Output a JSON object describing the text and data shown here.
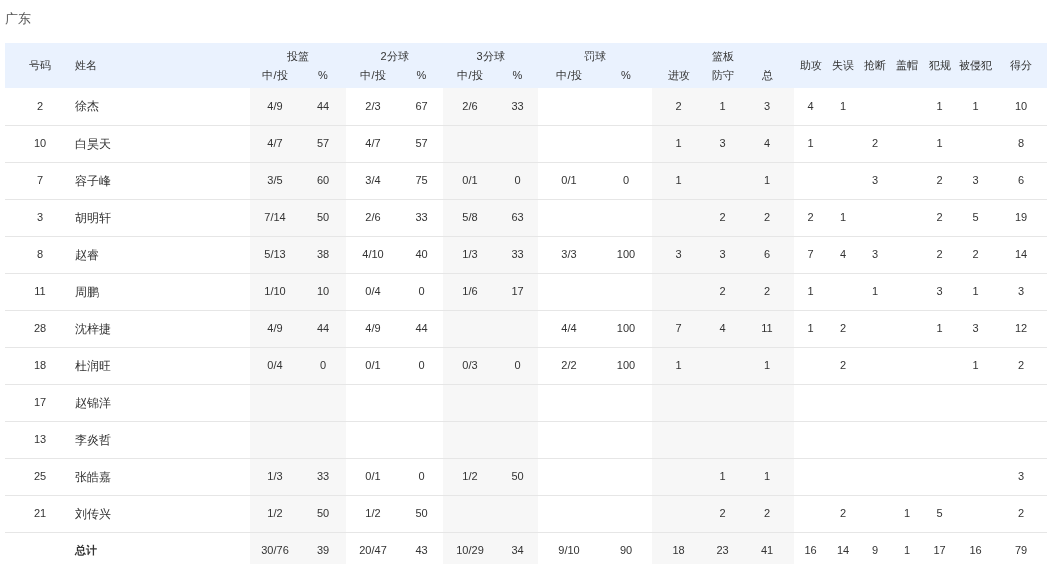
{
  "title": "广东",
  "table": {
    "header": {
      "number": "号码",
      "name": "姓名",
      "groups": [
        {
          "label": "投篮",
          "sub": [
            "中/投",
            "%"
          ]
        },
        {
          "label": "2分球",
          "sub": [
            "中/投",
            "%"
          ]
        },
        {
          "label": "3分球",
          "sub": [
            "中/投",
            "%"
          ]
        },
        {
          "label": "罚球",
          "sub": [
            "中/投",
            "%"
          ]
        },
        {
          "label": "篮板",
          "sub": [
            "进攻",
            "防守",
            "总"
          ]
        }
      ],
      "singles": [
        "助攻",
        "失误",
        "抢断",
        "盖帽",
        "犯规",
        "被侵犯",
        "得分"
      ]
    },
    "rows": [
      {
        "kind": "player",
        "number": "2",
        "name": "徐杰",
        "stats": {
          "fg": "4/9",
          "fg_pct": "44",
          "p2": "2/3",
          "p2_pct": "67",
          "p3": "2/6",
          "p3_pct": "33",
          "oreb": "2",
          "dreb": "1",
          "reb": "3",
          "ast": "4",
          "to": "1",
          "pf": "1",
          "fd": "1",
          "pts": "10"
        }
      },
      {
        "kind": "player",
        "number": "10",
        "name": "白昊天",
        "stats": {
          "fg": "4/7",
          "fg_pct": "57",
          "p2": "4/7",
          "p2_pct": "57",
          "oreb": "1",
          "dreb": "3",
          "reb": "4",
          "ast": "1",
          "stl": "2",
          "pf": "1",
          "pts": "8"
        }
      },
      {
        "kind": "player",
        "number": "7",
        "name": "容子峰",
        "stats": {
          "fg": "3/5",
          "fg_pct": "60",
          "p2": "3/4",
          "p2_pct": "75",
          "p3": "0/1",
          "p3_pct": "0",
          "ft": "0/1",
          "ft_pct": "0",
          "oreb": "1",
          "reb": "1",
          "stl": "3",
          "pf": "2",
          "fd": "3",
          "pts": "6"
        }
      },
      {
        "kind": "player",
        "number": "3",
        "name": "胡明轩",
        "stats": {
          "fg": "7/14",
          "fg_pct": "50",
          "p2": "2/6",
          "p2_pct": "33",
          "p3": "5/8",
          "p3_pct": "63",
          "dreb": "2",
          "reb": "2",
          "ast": "2",
          "to": "1",
          "pf": "2",
          "fd": "5",
          "pts": "19"
        }
      },
      {
        "kind": "player",
        "number": "8",
        "name": "赵睿",
        "stats": {
          "fg": "5/13",
          "fg_pct": "38",
          "p2": "4/10",
          "p2_pct": "40",
          "p3": "1/3",
          "p3_pct": "33",
          "ft": "3/3",
          "ft_pct": "100",
          "oreb": "3",
          "dreb": "3",
          "reb": "6",
          "ast": "7",
          "to": "4",
          "stl": "3",
          "pf": "2",
          "fd": "2",
          "pts": "14"
        }
      },
      {
        "kind": "player",
        "number": "11",
        "name": "周鹏",
        "stats": {
          "fg": "1/10",
          "fg_pct": "10",
          "p2": "0/4",
          "p2_pct": "0",
          "p3": "1/6",
          "p3_pct": "17",
          "dreb": "2",
          "reb": "2",
          "ast": "1",
          "stl": "1",
          "pf": "3",
          "fd": "1",
          "pts": "3"
        }
      },
      {
        "kind": "player",
        "number": "28",
        "name": "沈梓捷",
        "stats": {
          "fg": "4/9",
          "fg_pct": "44",
          "p2": "4/9",
          "p2_pct": "44",
          "ft": "4/4",
          "ft_pct": "100",
          "oreb": "7",
          "dreb": "4",
          "reb": "11",
          "ast": "1",
          "to": "2",
          "pf": "1",
          "fd": "3",
          "pts": "12"
        }
      },
      {
        "kind": "player",
        "number": "18",
        "name": "杜润旺",
        "stats": {
          "fg": "0/4",
          "fg_pct": "0",
          "p2": "0/1",
          "p2_pct": "0",
          "p3": "0/3",
          "p3_pct": "0",
          "ft": "2/2",
          "ft_pct": "100",
          "oreb": "1",
          "reb": "1",
          "to": "2",
          "fd": "1",
          "pts": "2"
        }
      },
      {
        "kind": "player",
        "number": "17",
        "name": "赵锦洋",
        "stats": {}
      },
      {
        "kind": "player",
        "number": "13",
        "name": "李炎哲",
        "stats": {}
      },
      {
        "kind": "player",
        "number": "25",
        "name": "张皓嘉",
        "stats": {
          "fg": "1/3",
          "fg_pct": "33",
          "p2": "0/1",
          "p2_pct": "0",
          "p3": "1/2",
          "p3_pct": "50",
          "dreb": "1",
          "reb": "1",
          "pts": "3"
        }
      },
      {
        "kind": "player",
        "number": "21",
        "name": "刘传兴",
        "stats": {
          "fg": "1/2",
          "fg_pct": "50",
          "p2": "1/2",
          "p2_pct": "50",
          "dreb": "2",
          "reb": "2",
          "to": "2",
          "blk": "1",
          "pf": "5",
          "pts": "2"
        }
      },
      {
        "kind": "total",
        "name": "总计",
        "stats": {
          "fg": "30/76",
          "fg_pct": "39",
          "p2": "20/47",
          "p2_pct": "43",
          "p3": "10/29",
          "p3_pct": "34",
          "ft": "9/10",
          "ft_pct": "90",
          "oreb": "18",
          "dreb": "23",
          "reb": "41",
          "ast": "16",
          "to": "14",
          "stl": "9",
          "blk": "1",
          "pf": "17",
          "fd": "16",
          "pts": "79"
        }
      }
    ]
  }
}
